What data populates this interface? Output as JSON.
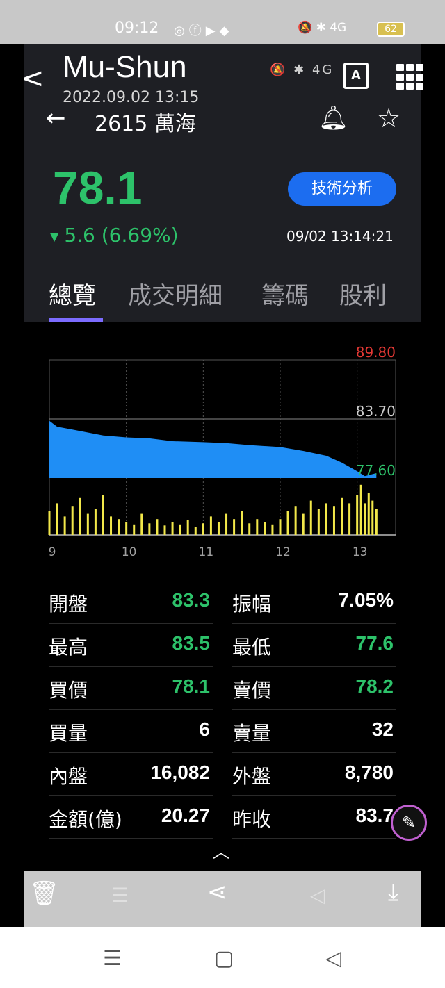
{
  "status_bar": {
    "time": "09:12",
    "app_icons": [
      "chrome-icon",
      "facebook-icon",
      "youtube-icon",
      "app-icon"
    ],
    "system_icons": "🔕 ✱ 4G",
    "battery": "62"
  },
  "viewer": {
    "title": "Mu-Shun",
    "date": "2022.09.02 13:15",
    "ocr_label": "A"
  },
  "stock": {
    "title": "2615 萬海",
    "price": "78.1",
    "change": "5.6 (6.69%)",
    "time": "09/02 13:14:21",
    "tech_button": "技術分析",
    "colors": {
      "up": "#e53935",
      "down": "#2dc26a",
      "accent": "#1c6df0",
      "tab_indicator": "#7c6cff"
    }
  },
  "tabs": [
    "總覽",
    "成交明細",
    "籌碼",
    "股利"
  ],
  "chart_data": {
    "type": "area",
    "price_levels": [
      "89.80",
      "83.70",
      "77.60"
    ],
    "x_ticks": [
      "9",
      "10",
      "11",
      "12",
      "13"
    ],
    "ylim": [
      77.6,
      89.8
    ],
    "reference": 83.7,
    "price_series": [
      {
        "t": 9.0,
        "v": 83.5
      },
      {
        "t": 9.1,
        "v": 82.9
      },
      {
        "t": 9.3,
        "v": 82.6
      },
      {
        "t": 9.5,
        "v": 82.3
      },
      {
        "t": 9.7,
        "v": 82.0
      },
      {
        "t": 10.0,
        "v": 81.8
      },
      {
        "t": 10.3,
        "v": 81.7
      },
      {
        "t": 10.6,
        "v": 81.4
      },
      {
        "t": 11.0,
        "v": 81.3
      },
      {
        "t": 11.3,
        "v": 81.2
      },
      {
        "t": 11.6,
        "v": 81.0
      },
      {
        "t": 12.0,
        "v": 80.8
      },
      {
        "t": 12.3,
        "v": 80.4
      },
      {
        "t": 12.6,
        "v": 79.9
      },
      {
        "t": 12.8,
        "v": 79.2
      },
      {
        "t": 13.0,
        "v": 78.3
      },
      {
        "t": 13.1,
        "v": 77.8
      },
      {
        "t": 13.25,
        "v": 78.1
      }
    ],
    "volume_series": [
      {
        "t": 9.0,
        "v": 45
      },
      {
        "t": 9.1,
        "v": 60
      },
      {
        "t": 9.2,
        "v": 35
      },
      {
        "t": 9.3,
        "v": 55
      },
      {
        "t": 9.4,
        "v": 70
      },
      {
        "t": 9.5,
        "v": 40
      },
      {
        "t": 9.6,
        "v": 50
      },
      {
        "t": 9.7,
        "v": 75
      },
      {
        "t": 9.8,
        "v": 35
      },
      {
        "t": 9.9,
        "v": 30
      },
      {
        "t": 10.0,
        "v": 25
      },
      {
        "t": 10.1,
        "v": 20
      },
      {
        "t": 10.2,
        "v": 40
      },
      {
        "t": 10.3,
        "v": 22
      },
      {
        "t": 10.4,
        "v": 30
      },
      {
        "t": 10.5,
        "v": 18
      },
      {
        "t": 10.6,
        "v": 25
      },
      {
        "t": 10.7,
        "v": 20
      },
      {
        "t": 10.8,
        "v": 28
      },
      {
        "t": 10.9,
        "v": 15
      },
      {
        "t": 11.0,
        "v": 22
      },
      {
        "t": 11.1,
        "v": 35
      },
      {
        "t": 11.2,
        "v": 25
      },
      {
        "t": 11.3,
        "v": 40
      },
      {
        "t": 11.4,
        "v": 30
      },
      {
        "t": 11.5,
        "v": 45
      },
      {
        "t": 11.6,
        "v": 22
      },
      {
        "t": 11.7,
        "v": 30
      },
      {
        "t": 11.8,
        "v": 25
      },
      {
        "t": 11.9,
        "v": 20
      },
      {
        "t": 12.0,
        "v": 30
      },
      {
        "t": 12.1,
        "v": 45
      },
      {
        "t": 12.2,
        "v": 55
      },
      {
        "t": 12.3,
        "v": 40
      },
      {
        "t": 12.4,
        "v": 65
      },
      {
        "t": 12.5,
        "v": 50
      },
      {
        "t": 12.6,
        "v": 60
      },
      {
        "t": 12.7,
        "v": 55
      },
      {
        "t": 12.8,
        "v": 70
      },
      {
        "t": 12.9,
        "v": 60
      },
      {
        "t": 13.0,
        "v": 75
      },
      {
        "t": 13.05,
        "v": 95
      },
      {
        "t": 13.1,
        "v": 60
      },
      {
        "t": 13.15,
        "v": 80
      },
      {
        "t": 13.2,
        "v": 65
      },
      {
        "t": 13.25,
        "v": 50
      }
    ]
  },
  "stats": [
    {
      "left_label": "開盤",
      "left_value": "83.3",
      "left_color": "green",
      "right_label": "振幅",
      "right_value": "7.05%",
      "right_color": "white"
    },
    {
      "left_label": "最高",
      "left_value": "83.5",
      "left_color": "green",
      "right_label": "最低",
      "right_value": "77.6",
      "right_color": "green"
    },
    {
      "left_label": "買價",
      "left_value": "78.1",
      "left_color": "green",
      "right_label": "賣價",
      "right_value": "78.2",
      "right_color": "green"
    },
    {
      "left_label": "買量",
      "left_value": "6",
      "left_color": "white",
      "right_label": "賣量",
      "right_value": "32",
      "right_color": "white"
    },
    {
      "left_label": "內盤",
      "left_value": "16,082",
      "left_color": "white",
      "right_label": "外盤",
      "right_value": "8,780",
      "right_color": "white"
    },
    {
      "left_label": "金額(億)",
      "left_value": "20.27",
      "left_color": "white",
      "right_label": "昨收",
      "right_value": "83.7",
      "right_color": "white"
    }
  ]
}
